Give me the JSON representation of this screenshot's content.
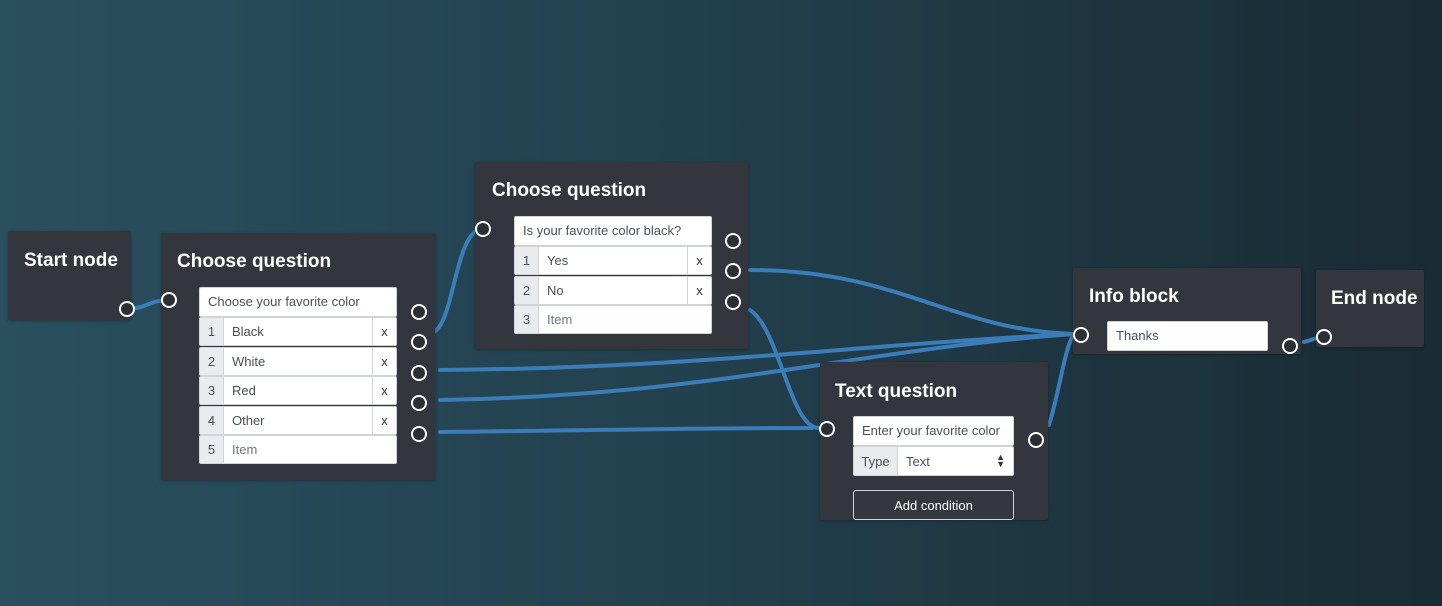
{
  "wire_color": "#3b7db8",
  "start_node": {
    "title": "Start node"
  },
  "choose1": {
    "title": "Choose question",
    "question": "Choose your favorite color",
    "items": [
      {
        "num": "1",
        "label": "Black"
      },
      {
        "num": "2",
        "label": "White"
      },
      {
        "num": "3",
        "label": "Red"
      },
      {
        "num": "4",
        "label": "Other"
      }
    ],
    "new_item": {
      "num": "5",
      "placeholder": "Item"
    },
    "delete_label": "x"
  },
  "choose2": {
    "title": "Choose question",
    "question": "Is your favorite color black?",
    "items": [
      {
        "num": "1",
        "label": "Yes"
      },
      {
        "num": "2",
        "label": "No"
      }
    ],
    "new_item": {
      "num": "3",
      "placeholder": "Item"
    },
    "delete_label": "x"
  },
  "text_question": {
    "title": "Text question",
    "question": "Enter your favorite color",
    "type_label": "Type",
    "type_value": "Text",
    "add_condition": "Add condition"
  },
  "info_block": {
    "title": "Info block",
    "text": "Thanks"
  },
  "end_node": {
    "title": "End node"
  }
}
